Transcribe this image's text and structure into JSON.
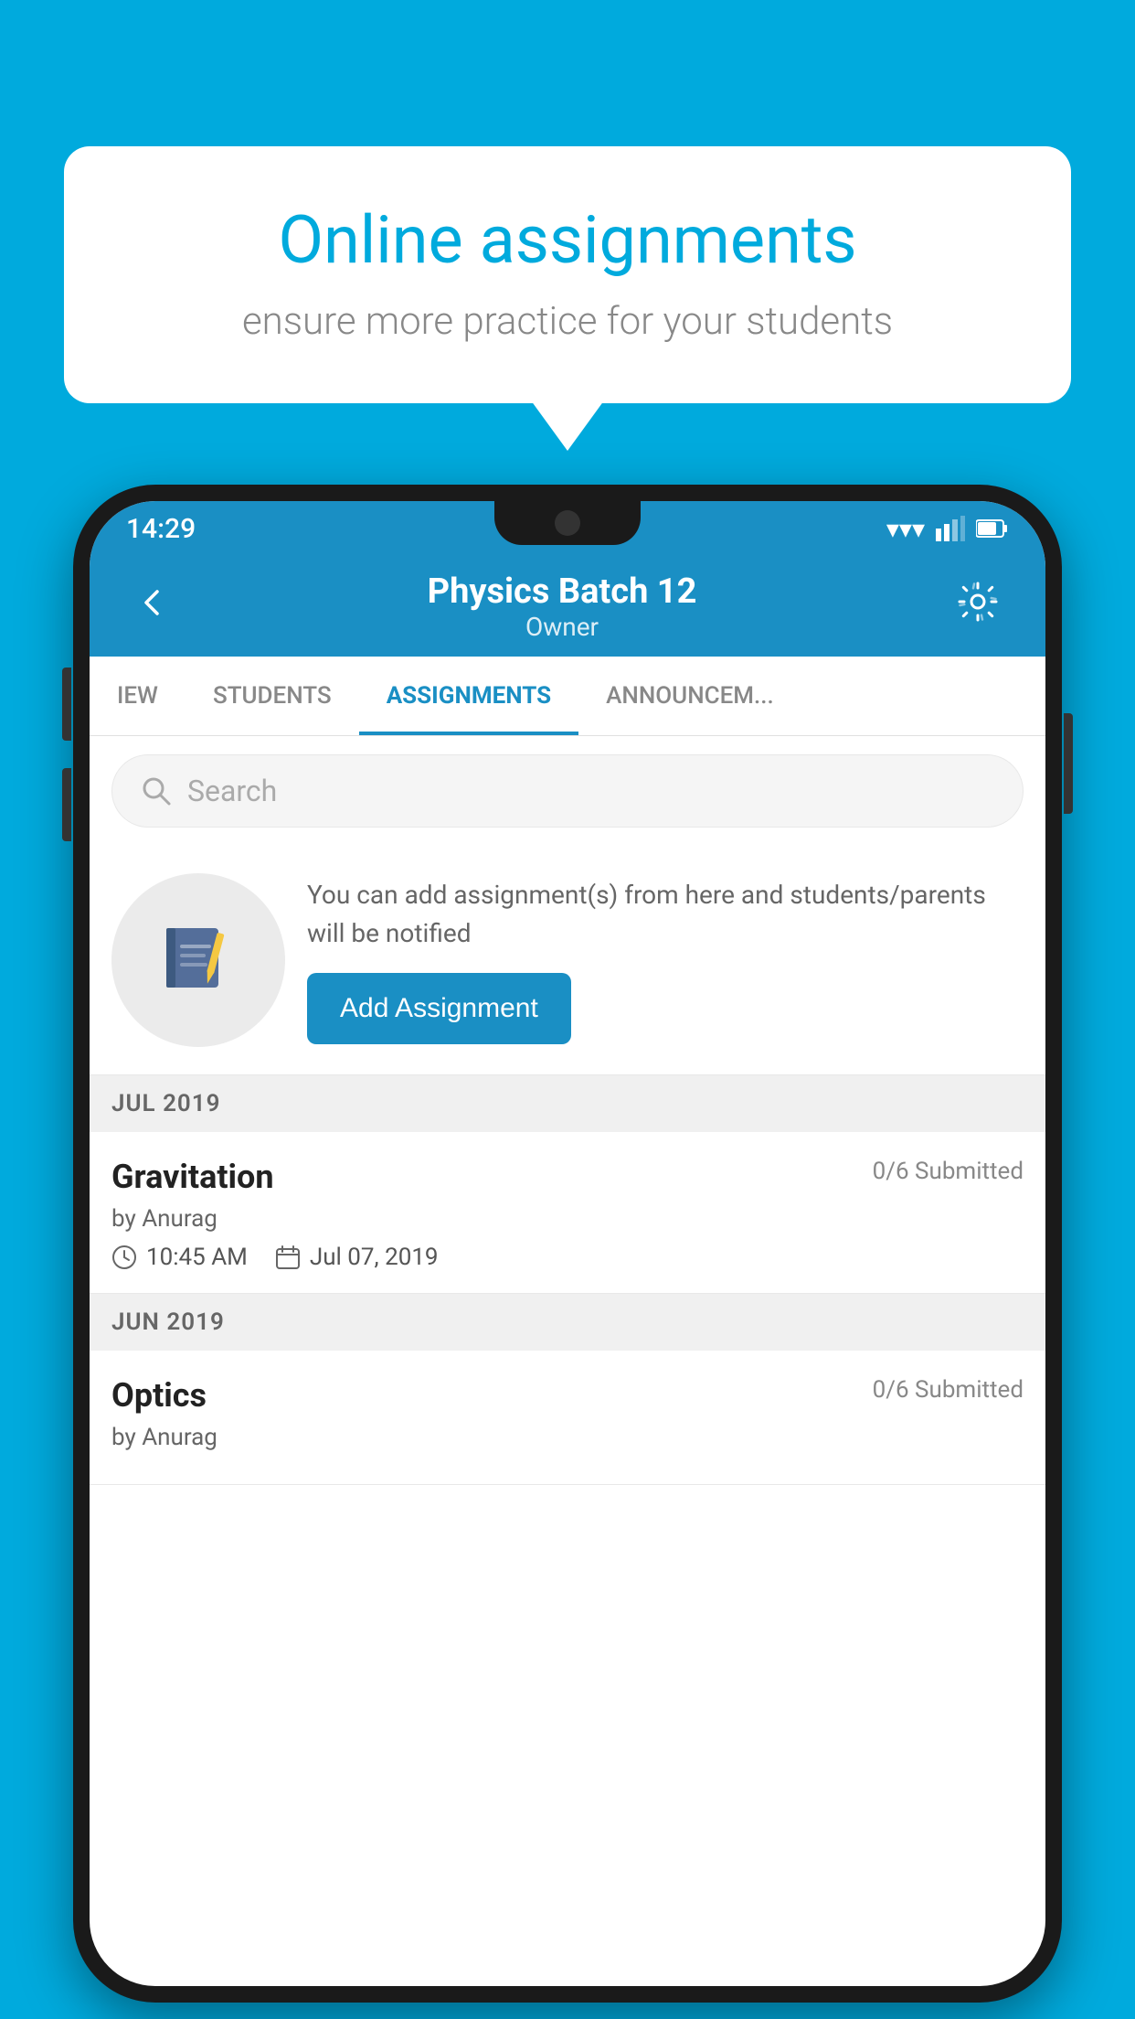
{
  "background_color": "#00AADD",
  "speech_bubble": {
    "title": "Online assignments",
    "subtitle": "ensure more practice for your students"
  },
  "status_bar": {
    "time": "14:29",
    "wifi": "▾",
    "signal": "▲",
    "battery": "▮"
  },
  "app_bar": {
    "title": "Physics Batch 12",
    "subtitle": "Owner",
    "back_label": "←",
    "settings_label": "⚙"
  },
  "tabs": [
    {
      "label": "IEW",
      "active": false
    },
    {
      "label": "STUDENTS",
      "active": false
    },
    {
      "label": "ASSIGNMENTS",
      "active": true
    },
    {
      "label": "ANNOUNCEM...",
      "active": false
    }
  ],
  "search": {
    "placeholder": "Search"
  },
  "promo": {
    "text": "You can add assignment(s) from here and students/parents will be notified",
    "button_label": "Add Assignment"
  },
  "sections": [
    {
      "header": "JUL 2019",
      "assignments": [
        {
          "title": "Gravitation",
          "submitted": "0/6 Submitted",
          "author": "by Anurag",
          "time": "10:45 AM",
          "date": "Jul 07, 2019"
        }
      ]
    },
    {
      "header": "JUN 2019",
      "assignments": [
        {
          "title": "Optics",
          "submitted": "0/6 Submitted",
          "author": "by Anurag",
          "time": "",
          "date": ""
        }
      ]
    }
  ]
}
